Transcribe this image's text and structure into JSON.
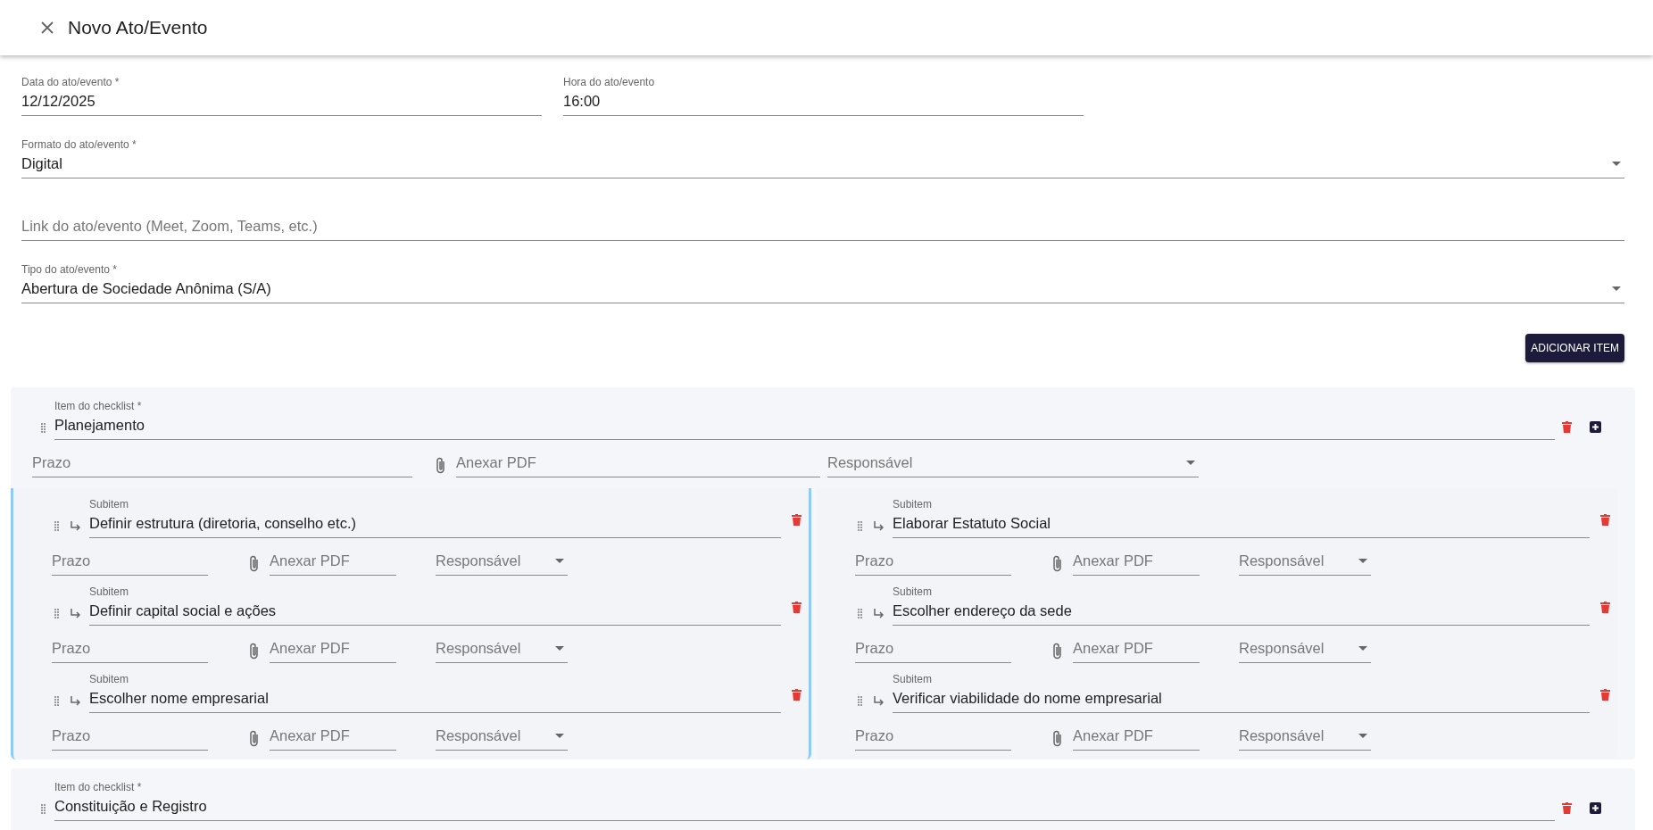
{
  "header": {
    "title": "Novo Ato/Evento"
  },
  "date_field": {
    "label": "Data do ato/evento *",
    "value": "12/12/2025"
  },
  "time_field": {
    "label": "Hora do ato/evento",
    "value": "16:00"
  },
  "format_field": {
    "label": "Formato do ato/evento *",
    "value": "Digital"
  },
  "link_field": {
    "placeholder": "Link do ato/evento (Meet, Zoom, Teams, etc.)"
  },
  "type_field": {
    "label": "Tipo do ato/evento *",
    "value": "Abertura de Sociedade Anônima (S/A)"
  },
  "add_button": {
    "label": "ADICIONAR ITEM"
  },
  "checklist": [
    {
      "label": "Item do checklist *",
      "value": "Planejamento",
      "deadline_placeholder": "Prazo",
      "attachment_placeholder": "Anexar PDF",
      "responsible_placeholder": "Responsável",
      "subitem_columns": [
        {
          "highlighted": true,
          "subitems": [
            {
              "label": "Subitem",
              "value": "Definir estrutura (diretoria, conselho etc.)",
              "deadline_placeholder": "Prazo",
              "attachment_placeholder": "Anexar PDF",
              "responsible_placeholder": "Responsável"
            },
            {
              "label": "Subitem",
              "value": "Definir capital social e ações",
              "deadline_placeholder": "Prazo",
              "attachment_placeholder": "Anexar PDF",
              "responsible_placeholder": "Responsável"
            },
            {
              "label": "Subitem",
              "value": "Escolher nome empresarial",
              "deadline_placeholder": "Prazo",
              "attachment_placeholder": "Anexar PDF",
              "responsible_placeholder": "Responsável"
            }
          ]
        },
        {
          "highlighted": false,
          "subitems": [
            {
              "label": "Subitem",
              "value": "Elaborar Estatuto Social",
              "deadline_placeholder": "Prazo",
              "attachment_placeholder": "Anexar PDF",
              "responsible_placeholder": "Responsável"
            },
            {
              "label": "Subitem",
              "value": "Escolher endereço da sede",
              "deadline_placeholder": "Prazo",
              "attachment_placeholder": "Anexar PDF",
              "responsible_placeholder": "Responsável"
            },
            {
              "label": "Subitem",
              "value": "Verificar viabilidade do nome empresarial",
              "deadline_placeholder": "Prazo",
              "attachment_placeholder": "Anexar PDF",
              "responsible_placeholder": "Responsável"
            }
          ]
        }
      ]
    },
    {
      "label": "Item do checklist *",
      "value": "Constituição e Registro"
    }
  ]
}
